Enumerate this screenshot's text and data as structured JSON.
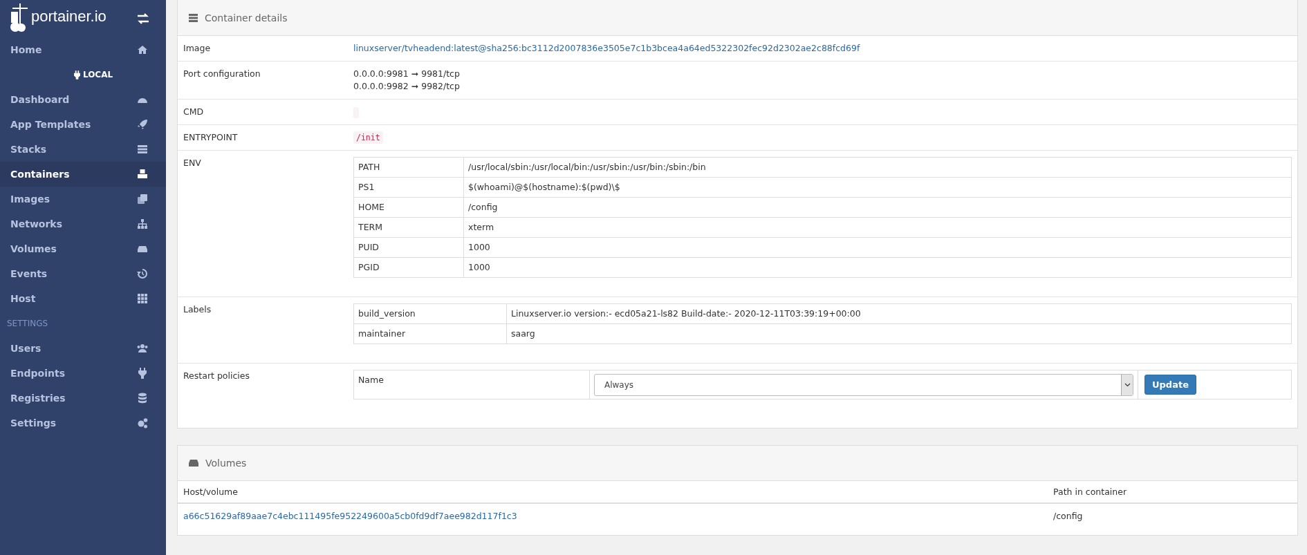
{
  "sidebar": {
    "logo_text": "portainer.io",
    "items": [
      {
        "label": "Home",
        "selected": false
      }
    ],
    "endpoint": "LOCAL",
    "endpoint_items": [
      {
        "label": "Dashboard",
        "selected": false
      },
      {
        "label": "App Templates",
        "selected": false
      },
      {
        "label": "Stacks",
        "selected": false
      },
      {
        "label": "Containers",
        "selected": true
      },
      {
        "label": "Images",
        "selected": false
      },
      {
        "label": "Networks",
        "selected": false
      },
      {
        "label": "Volumes",
        "selected": false
      },
      {
        "label": "Events",
        "selected": false
      },
      {
        "label": "Host",
        "selected": false
      }
    ],
    "section": "SETTINGS",
    "settings_items": [
      {
        "label": "Users",
        "selected": false
      },
      {
        "label": "Endpoints",
        "selected": false
      },
      {
        "label": "Registries",
        "selected": false
      },
      {
        "label": "Settings",
        "selected": false
      }
    ]
  },
  "details": {
    "title": "Container details",
    "rows": [
      {
        "kind": "link",
        "label": "Image",
        "value": "linuxserver/tvheadend:latest@sha256:bc3112d2007836e3505e7c1b3bcea4a64ed5322302fec92d2302ae2c88fcd69f"
      },
      {
        "kind": "lines",
        "label": "Port configuration",
        "lines": [
          "0.0.0.0:9981 ➞ 9981/tcp",
          "0.0.0.0:9982 ➞ 9982/tcp"
        ]
      },
      {
        "kind": "emptycode",
        "label": "CMD"
      },
      {
        "kind": "code",
        "label": "ENTRYPOINT",
        "value": "/init"
      },
      {
        "kind": "table",
        "label": "ENV",
        "pairs": [
          {
            "key": "PATH",
            "value": "/usr/local/sbin:/usr/local/bin:/usr/sbin:/usr/bin:/sbin:/bin"
          },
          {
            "key": "PS1",
            "value": "$(whoami)@$(hostname):$(pwd)\\$"
          },
          {
            "key": "HOME",
            "value": "/config"
          },
          {
            "key": "TERM",
            "value": "xterm"
          },
          {
            "key": "PUID",
            "value": "1000"
          },
          {
            "key": "PGID",
            "value": "1000"
          }
        ]
      },
      {
        "kind": "table",
        "label": "Labels",
        "pairs": [
          {
            "key": "build_version",
            "value": "Linuxserver.io version:- ecd05a21-ls82 Build-date:- 2020-12-11T03:39:19+00:00"
          },
          {
            "key": "maintainer",
            "value": "saarg"
          }
        ]
      },
      {
        "kind": "policy",
        "label": "Restart policies",
        "name_label": "Name",
        "select_value": "Always",
        "button": "Update"
      }
    ]
  },
  "volumes": {
    "title": "Volumes",
    "columns": [
      "Host/volume",
      "Path in container"
    ],
    "rows": [
      {
        "host": "a66c51629af89aae7c4ebc111495fe952249600a5cb0fd9df7aee982d117f1c3",
        "path": "/config"
      }
    ]
  }
}
